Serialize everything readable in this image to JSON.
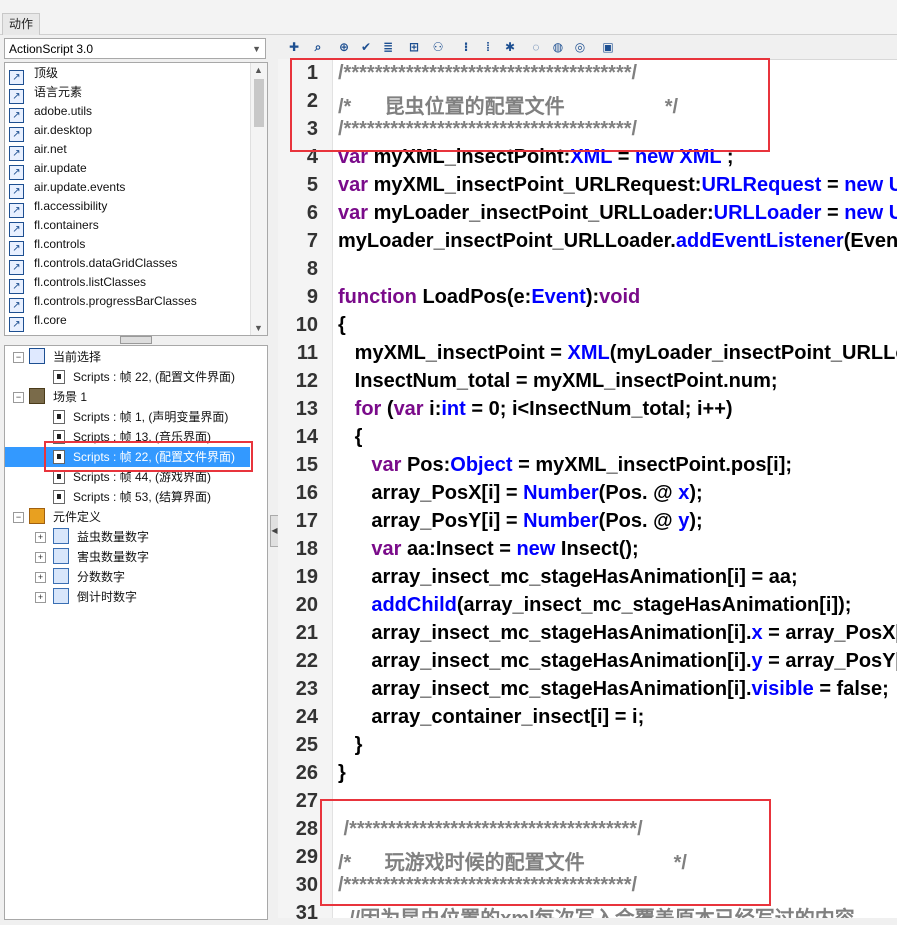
{
  "panel": {
    "title": "动作"
  },
  "library": {
    "combo_value": "ActionScript 3.0",
    "items": [
      "顶级",
      "语言元素",
      "adobe.utils",
      "air.desktop",
      "air.net",
      "air.update",
      "air.update.events",
      "fl.accessibility",
      "fl.containers",
      "fl.controls",
      "fl.controls.dataGridClasses",
      "fl.controls.listClasses",
      "fl.controls.progressBarClasses",
      "fl.core"
    ]
  },
  "tree": {
    "current": "当前选择",
    "current_script": "Scripts : 帧 22, (配置文件界面)",
    "scene": "场景 1",
    "scripts": [
      "Scripts : 帧 1, (声明变量界面)",
      "Scripts : 帧 13, (音乐界面)",
      "Scripts : 帧 22, (配置文件界面)",
      "Scripts : 帧 44, (游戏界面)",
      "Scripts : 帧 53, (结算界面)"
    ],
    "symbols": "元件定义",
    "symbol_items": [
      "益虫数量数字",
      "害虫数量数字",
      "分数数字",
      "倒计时数字"
    ]
  },
  "toolbar": {
    "icons": [
      "add-statement-icon",
      "find-icon",
      "target-icon",
      "check-syntax-icon",
      "auto-format-icon",
      "code-hint-icon",
      "debug-icon",
      "collapse-braces-icon",
      "collapse-selection-icon",
      "expand-all-icon",
      "block-comment-icon",
      "line-comment-icon",
      "remove-comment-icon",
      "script-assist-icon"
    ]
  },
  "code_lines": [
    [
      [
        "cm",
        "/*************************************/"
      ]
    ],
    [
      [
        "cm",
        "/*      昆虫位置的配置文件                  */"
      ]
    ],
    [
      [
        "cm",
        "/*************************************/"
      ]
    ],
    [
      [
        "kp",
        "var "
      ],
      [
        "",
        "myXML_insectPoint:"
      ],
      [
        "ty",
        "XML"
      ],
      [
        "",
        " = "
      ],
      [
        "kw",
        "new "
      ],
      [
        "ty",
        "XML"
      ],
      [
        "",
        " ;"
      ]
    ],
    [
      [
        "kp",
        "var "
      ],
      [
        "",
        "myXML_insectPoint_URLRequest:"
      ],
      [
        "ty",
        "URLRequest"
      ],
      [
        "",
        " = "
      ],
      [
        "kw",
        "new URLRequest"
      ]
    ],
    [
      [
        "kp",
        "var "
      ],
      [
        "",
        "myLoader_insectPoint_URLLoader:"
      ],
      [
        "ty",
        "URLLoader"
      ],
      [
        "",
        " = "
      ],
      [
        "kw",
        "new URLLoader"
      ]
    ],
    [
      [
        "",
        "myLoader_insectPoint_URLLoader."
      ],
      [
        "kw",
        "addEventListener"
      ],
      [
        "",
        "(Event"
      ]
    ],
    [
      [
        "",
        ""
      ]
    ],
    [
      [
        "kp",
        "function "
      ],
      [
        "",
        "LoadPos(e:"
      ],
      [
        "ty",
        "Event"
      ],
      [
        "",
        "):"
      ],
      [
        "kp",
        "void"
      ]
    ],
    [
      [
        "",
        "{"
      ]
    ],
    [
      [
        "",
        "   myXML_insectPoint = "
      ],
      [
        "ty",
        "XML"
      ],
      [
        "",
        "(myLoader_insectPoint_URLLoader"
      ]
    ],
    [
      [
        "",
        "   InsectNum_total = myXML_insectPoint.num;"
      ]
    ],
    [
      [
        "kp",
        "   for "
      ],
      [
        "",
        "("
      ],
      [
        "kp",
        "var "
      ],
      [
        "",
        "i:"
      ],
      [
        "ty",
        "int"
      ],
      [
        "",
        " = 0; i<InsectNum_total; i++)"
      ]
    ],
    [
      [
        "",
        "   {"
      ]
    ],
    [
      [
        "kp",
        "      var "
      ],
      [
        "",
        "Pos:"
      ],
      [
        "ty",
        "Object"
      ],
      [
        "",
        " = myXML_insectPoint.pos[i];"
      ]
    ],
    [
      [
        "",
        "      array_PosX[i] = "
      ],
      [
        "ty",
        "Number"
      ],
      [
        "",
        "(Pos. @ "
      ],
      [
        "ty",
        "x"
      ],
      [
        "",
        ");"
      ]
    ],
    [
      [
        "",
        "      array_PosY[i] = "
      ],
      [
        "ty",
        "Number"
      ],
      [
        "",
        "(Pos. @ "
      ],
      [
        "ty",
        "y"
      ],
      [
        "",
        ");"
      ]
    ],
    [
      [
        "kp",
        "      var "
      ],
      [
        "",
        "aa:Insect = "
      ],
      [
        "kw",
        "new "
      ],
      [
        "",
        "Insect();"
      ]
    ],
    [
      [
        "",
        "      array_insect_mc_stageHasAnimation[i] = aa;"
      ]
    ],
    [
      [
        "kw",
        "      addChild"
      ],
      [
        "",
        "(array_insect_mc_stageHasAnimation[i]);"
      ]
    ],
    [
      [
        "",
        "      array_insect_mc_stageHasAnimation[i]."
      ],
      [
        "ty",
        "x"
      ],
      [
        "",
        " = array_PosX[i];"
      ]
    ],
    [
      [
        "",
        "      array_insect_mc_stageHasAnimation[i]."
      ],
      [
        "ty",
        "y"
      ],
      [
        "",
        " = array_PosY[i];"
      ]
    ],
    [
      [
        "",
        "      array_insect_mc_stageHasAnimation[i]."
      ],
      [
        "ty",
        "visible"
      ],
      [
        "",
        " = false;"
      ]
    ],
    [
      [
        "",
        "      array_container_insect[i] = i;"
      ]
    ],
    [
      [
        "",
        "   }"
      ]
    ],
    [
      [
        "",
        "}"
      ]
    ],
    [
      [
        "",
        ""
      ]
    ],
    [
      [
        "cm",
        " /*************************************/"
      ]
    ],
    [
      [
        "cm",
        "/*      玩游戏时候的配置文件                */"
      ]
    ],
    [
      [
        "cm",
        "/*************************************/"
      ]
    ],
    [
      [
        "cm",
        "  //因为昆虫位置的xml每次写入会覆盖原本已经写过的内容"
      ]
    ]
  ],
  "line_numbers": [
    "1",
    "2",
    "3",
    "4",
    "5",
    "6",
    "7",
    "8",
    "9",
    "10",
    "11",
    "12",
    "13",
    "14",
    "15",
    "16",
    "17",
    "18",
    "19",
    "20",
    "21",
    "22",
    "23",
    "24",
    "25",
    "26",
    "27",
    "28",
    "29",
    "30",
    "31"
  ]
}
